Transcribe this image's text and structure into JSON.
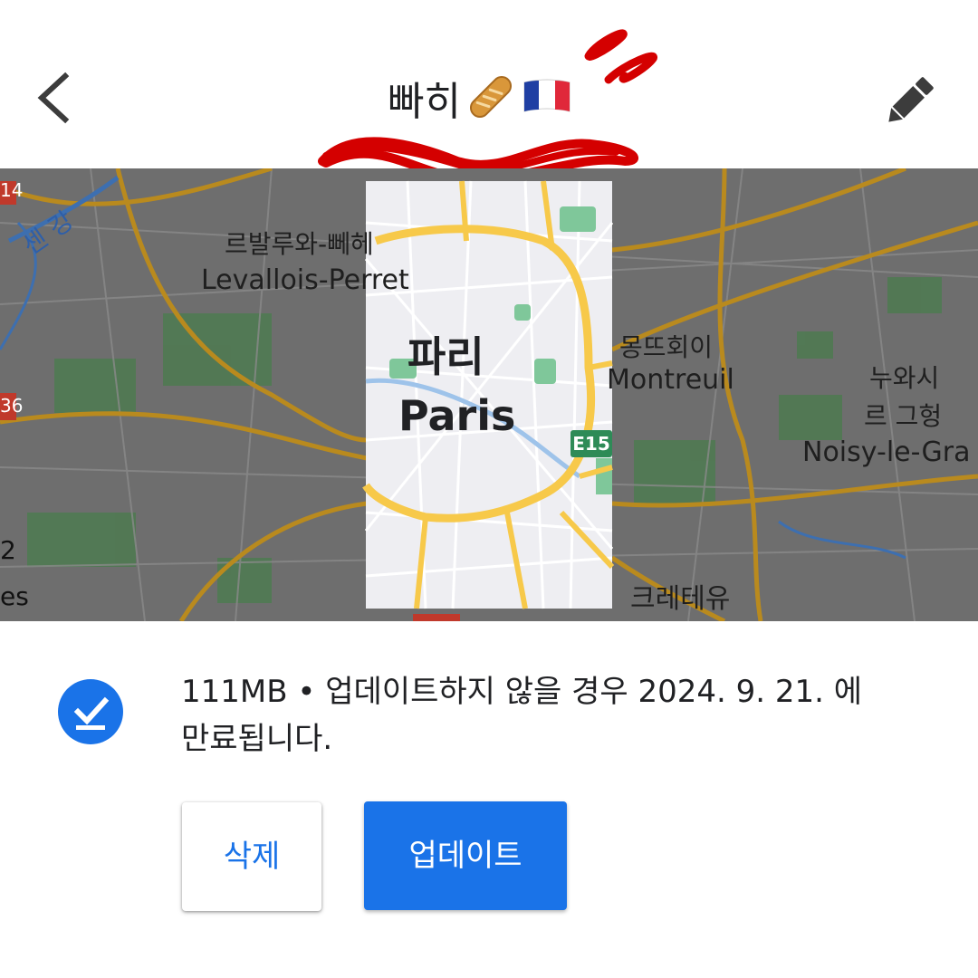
{
  "header": {
    "title": "빠히",
    "title_emojis": [
      "🥖",
      "🇫🇷"
    ],
    "back_icon": "chevron-left-icon",
    "edit_icon": "pencil-icon"
  },
  "map": {
    "labels": {
      "seine_ko": "센 강",
      "levallois_ko": "르발루와-뻬헤",
      "levallois": "Levallois-Perret",
      "paris_ko": "파리",
      "paris": "Paris",
      "montreuil_ko": "몽뜨회이",
      "montreuil": "Montreuil",
      "noisy_ko_1": "누와시",
      "noisy_ko_2": "르 그헝",
      "noisy": "Noisy-le-Gra",
      "creteil_ko": "크레테유",
      "road_shield": "E15",
      "edge_left_top": "14",
      "edge_left_mid": "36",
      "edge_left_bot1": "2",
      "edge_left_bot2": "es"
    }
  },
  "download": {
    "status_icon": "download-done-icon",
    "text": "111MB • 업데이트하지 않을 경우 2024. 9. 21. 에 만료됩니다."
  },
  "actions": {
    "delete_label": "삭제",
    "update_label": "업데이트"
  },
  "colors": {
    "accent": "#1a73e8",
    "doodle": "#d40000"
  }
}
